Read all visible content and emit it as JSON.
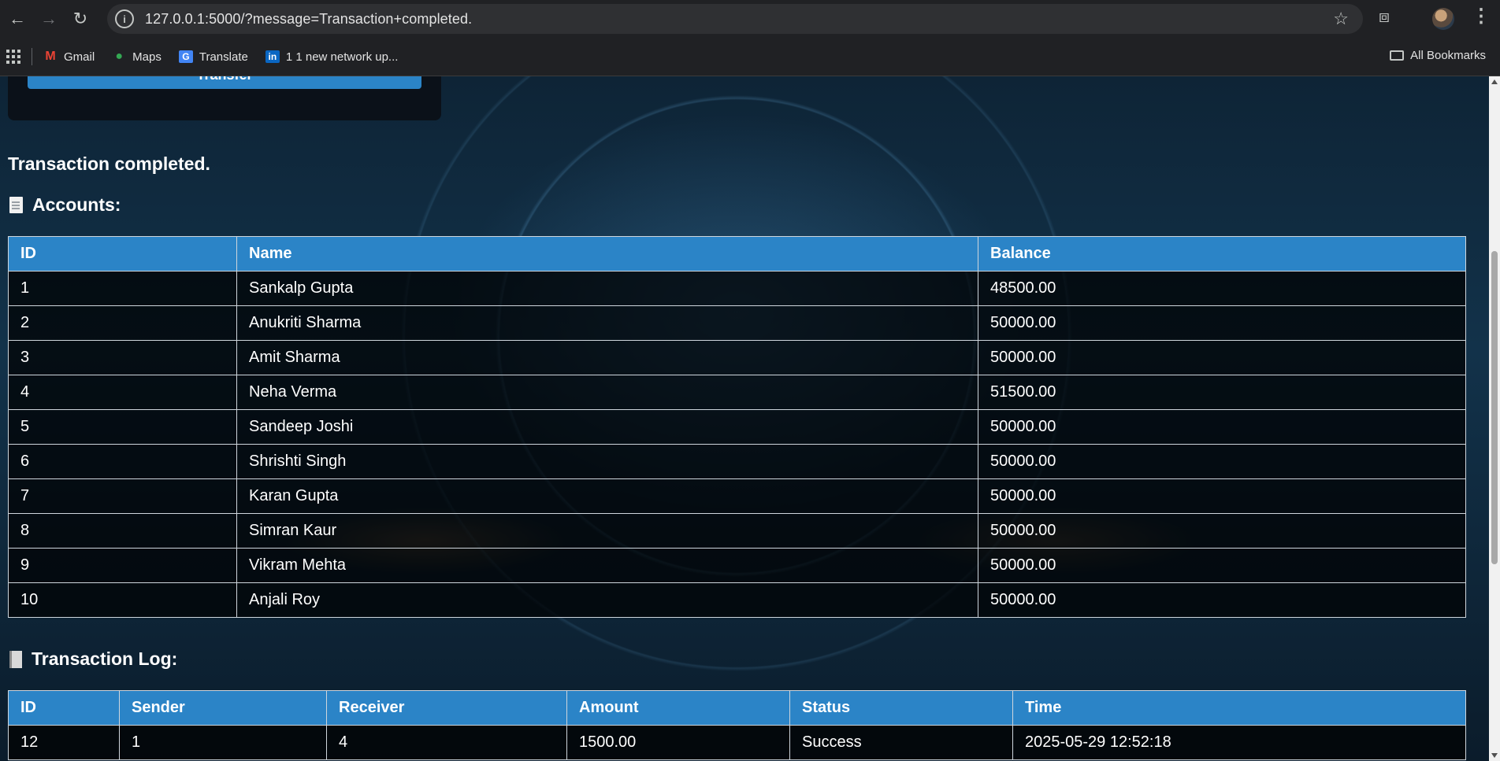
{
  "browser": {
    "url": "127.0.0.1:5000/?message=Transaction+completed.",
    "bookmarks": [
      {
        "label": "Gmail",
        "icon": "gmail-icon"
      },
      {
        "label": "Maps",
        "icon": "maps-icon"
      },
      {
        "label": "Translate",
        "icon": "translate-icon"
      },
      {
        "label": "1 1 new network up...",
        "icon": "linkedin-icon"
      }
    ],
    "all_bookmarks": "All Bookmarks"
  },
  "form": {
    "transfer_label": "Transfer"
  },
  "message": "Transaction completed.",
  "accounts": {
    "heading": "Accounts:",
    "columns": [
      "ID",
      "Name",
      "Balance"
    ],
    "rows": [
      [
        "1",
        "Sankalp Gupta",
        "48500.00"
      ],
      [
        "2",
        "Anukriti Sharma",
        "50000.00"
      ],
      [
        "3",
        "Amit Sharma",
        "50000.00"
      ],
      [
        "4",
        "Neha Verma",
        "51500.00"
      ],
      [
        "5",
        "Sandeep Joshi",
        "50000.00"
      ],
      [
        "6",
        "Shrishti Singh",
        "50000.00"
      ],
      [
        "7",
        "Karan Gupta",
        "50000.00"
      ],
      [
        "8",
        "Simran Kaur",
        "50000.00"
      ],
      [
        "9",
        "Vikram Mehta",
        "50000.00"
      ],
      [
        "10",
        "Anjali Roy",
        "50000.00"
      ]
    ]
  },
  "transactions": {
    "heading": "Transaction Log:",
    "columns": [
      "ID",
      "Sender",
      "Receiver",
      "Amount",
      "Status",
      "Time"
    ],
    "rows": [
      [
        "12",
        "1",
        "4",
        "1500.00",
        "Success",
        "2025-05-29 12:52:18"
      ]
    ]
  },
  "colors": {
    "header_blue": "#2b84c7",
    "chrome_bg": "#202124"
  }
}
